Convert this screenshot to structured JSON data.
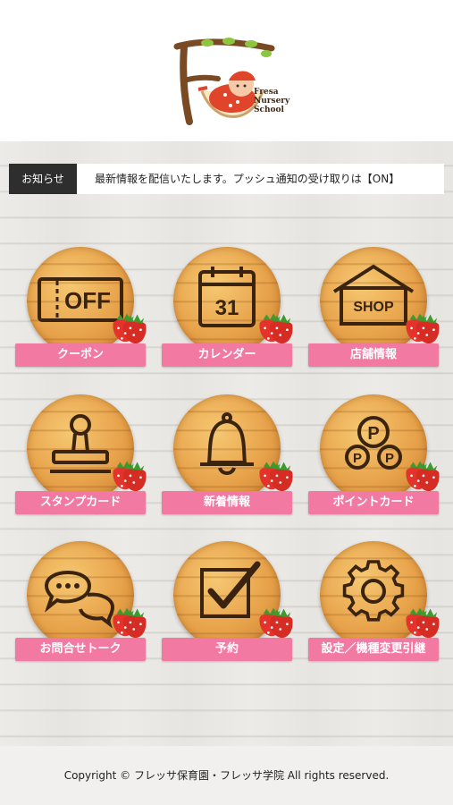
{
  "logo": {
    "line1": "Fresa",
    "line2": "Nursery",
    "line3": "School"
  },
  "news": {
    "label": "お知らせ",
    "text": "最新情報を配信いたします。プッシュ通知の受け取りは【ON】"
  },
  "menu": [
    {
      "label": "クーポン",
      "icon": "off-ticket-icon"
    },
    {
      "label": "カレンダー",
      "icon": "calendar-icon",
      "icon_text": "31"
    },
    {
      "label": "店舗情報",
      "icon": "shop-icon",
      "icon_text": "SHOP"
    },
    {
      "label": "スタンプカード",
      "icon": "stamp-icon"
    },
    {
      "label": "新着情報",
      "icon": "bell-icon"
    },
    {
      "label": "ポイントカード",
      "icon": "points-icon"
    },
    {
      "label": "お問合せトーク",
      "icon": "chat-icon"
    },
    {
      "label": "予約",
      "icon": "checkbox-icon"
    },
    {
      "label": "設定／機種変更引継",
      "icon": "gear-icon"
    }
  ],
  "icon_texts": {
    "off": "OFF",
    "p": "P"
  },
  "footer": {
    "copyright": "Copyright © フレッサ保育園・フレッサ学院 All rights reserved."
  },
  "colors": {
    "accent": "#f279a1",
    "wood": "#e7a24a",
    "news_label_bg": "#2e2e2e"
  }
}
